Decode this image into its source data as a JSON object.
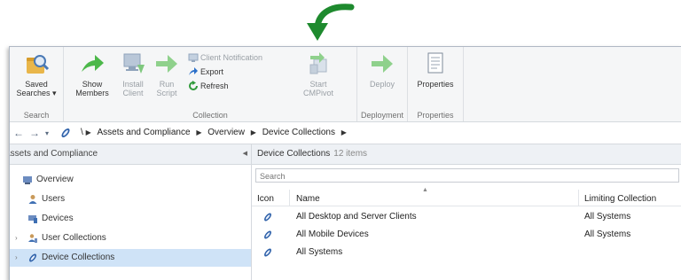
{
  "ribbon": {
    "groups": [
      {
        "label": "Search"
      },
      {
        "label": "Collection"
      },
      {
        "label": "Deployment"
      },
      {
        "label": "Properties"
      }
    ],
    "saved_searches": {
      "line1": "Saved",
      "line2": "Searches ▾"
    },
    "show_members": {
      "line1": "Show",
      "line2": "Members"
    },
    "install_client": {
      "line1": "Install",
      "line2": "Client"
    },
    "run_script": {
      "line1": "Run",
      "line2": "Script"
    },
    "client_notification": "Client Notification",
    "export": "Export",
    "refresh": "Refresh",
    "start_cmpivot": {
      "line1": "Start",
      "line2": "CMPivot"
    },
    "deploy": {
      "line1": "Deploy"
    },
    "properties": {
      "line1": "Properties"
    }
  },
  "addressbar": {
    "back_icon": "back-arrow-icon",
    "forward_icon": "forward-arrow-icon",
    "root": "\\",
    "crumbs": [
      "Assets and Compliance",
      "Overview",
      "Device Collections"
    ]
  },
  "nav": {
    "header": "Assets and Compliance",
    "items": [
      {
        "label": "Overview",
        "icon": "overview-icon"
      },
      {
        "label": "Users",
        "icon": "user-icon"
      },
      {
        "label": "Devices",
        "icon": "devices-icon"
      },
      {
        "label": "User Collections",
        "icon": "user-collections-icon"
      },
      {
        "label": "Device Collections",
        "icon": "device-collections-icon"
      }
    ]
  },
  "content": {
    "title": "Device Collections",
    "count": "12 items",
    "search_placeholder": "Search",
    "columns": {
      "icon": "Icon",
      "name": "Name",
      "limiting": "Limiting Collection"
    },
    "rows": [
      {
        "name": "All Desktop and Server Clients",
        "limiting": "All Systems"
      },
      {
        "name": "All Mobile Devices",
        "limiting": "All Systems"
      },
      {
        "name": "All Systems",
        "limiting": ""
      }
    ]
  },
  "colors": {
    "annotation_arrow": "#1e8a2e",
    "ribbon_bg": "#f5f6f7",
    "selected_bg": "#cfe3f7",
    "green_arrow": "#4cb84a"
  }
}
